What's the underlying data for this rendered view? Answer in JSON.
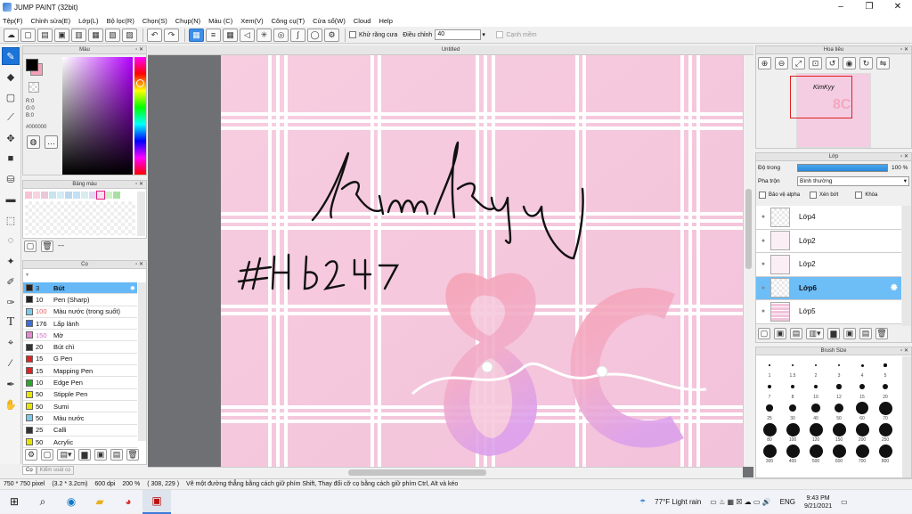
{
  "window": {
    "title": "JUMP PAINT (32bit)",
    "minimize": "–",
    "maximize": "❐",
    "close": "✕"
  },
  "menu": [
    "Tệp(F)",
    "Chỉnh sửa(E)",
    "Lớp(L)",
    "Bộ lọc(R)",
    "Chọn(S)",
    "Chụp(N)",
    "Màu (C)",
    "Xem(V)",
    "Công cụ(T)",
    "Cửa sổ(W)",
    "Cloud",
    "Help"
  ],
  "toolbar": {
    "antialias_label": "Khử răng cưa",
    "adjust_label": "Điều chỉnh",
    "adjust_value": "40",
    "grid_label": "Cạnh mềm"
  },
  "panels": {
    "color": "Màu",
    "swatch": "Bảng màu",
    "brush": "Cọ",
    "navigator": "Hoa tiêu",
    "layer": "Lớp",
    "brush_size": "Brush Size"
  },
  "color": {
    "r": "R:0",
    "g": "G:0",
    "b": "B:0",
    "hex": "#000000"
  },
  "canvas": {
    "tab_title": "Untitled",
    "signature": "KimKyy",
    "tag": "#Hb247",
    "big_text": "8C"
  },
  "brushes": [
    {
      "size": "3",
      "name": "Bút",
      "color": "#222222",
      "selected": true
    },
    {
      "size": "10",
      "name": "Pen (Sharp)",
      "color": "#222222"
    },
    {
      "size": "100",
      "name": "Màu nước (trong suốt)",
      "color": "#7ec8ea"
    },
    {
      "size": "176",
      "name": "Lấp lánh",
      "color": "#3b6fd8"
    },
    {
      "size": "150",
      "name": "Mờ",
      "color": "#e58ad0"
    },
    {
      "size": "20",
      "name": "Bút chì",
      "color": "#333333"
    },
    {
      "size": "15",
      "name": "G Pen",
      "color": "#e02424"
    },
    {
      "size": "15",
      "name": "Mapping Pen",
      "color": "#e02424"
    },
    {
      "size": "10",
      "name": "Edge Pen",
      "color": "#2aa82a"
    },
    {
      "size": "50",
      "name": "Stipple Pen",
      "color": "#e6e600"
    },
    {
      "size": "50",
      "name": "Sumi",
      "color": "#e6e600"
    },
    {
      "size": "50",
      "name": "Màu nước",
      "color": "#7ec8ea"
    },
    {
      "size": "25",
      "name": "Calli",
      "color": "#333333"
    },
    {
      "size": "50",
      "name": "Acrylic",
      "color": "#e6e600"
    }
  ],
  "brush_footer": {
    "tab1": "Cọ",
    "tab2": "Kiểm soát cọ"
  },
  "layer": {
    "opacity_label": "Độ trong",
    "opacity_value": "100 %",
    "blend_label": "Pha trộn",
    "blend_value": "Bình thường",
    "protect_alpha": "Bảo vệ alpha",
    "clipping": "Xén bớt",
    "lock": "Khóa"
  },
  "layers": [
    {
      "name": "Lớp4",
      "selected": false
    },
    {
      "name": "Lớp2",
      "selected": false
    },
    {
      "name": "Lớp2",
      "selected": false
    },
    {
      "name": "Lớp6",
      "selected": true
    },
    {
      "name": "Lớp5",
      "selected": false
    }
  ],
  "brush_sizes": [
    "1",
    "1.5",
    "2",
    "3",
    "4",
    "5",
    "7",
    "8",
    "10",
    "12",
    "15",
    "20",
    "25",
    "30",
    "40",
    "50",
    "60",
    "70",
    "80",
    "100",
    "120",
    "150",
    "200",
    "250",
    "300",
    "400",
    "500",
    "600",
    "700",
    "800",
    "1000"
  ],
  "status": {
    "dimensions": "750 * 750 pixel",
    "physical": "(3.2 * 3.2cm)",
    "dpi": "600 dpi",
    "zoom": "200 %",
    "coords": "( 308, 229 )",
    "hint": "Vẽ một đường thẳng bằng cách giữ phím Shift, Thay đổi cỡ cọ bằng cách giữ phím Ctrl, Alt và kéo"
  },
  "taskbar": {
    "weather": "77°F  Light rain",
    "lang": "ENG",
    "time": "9:43 PM",
    "date": "9/21/2021"
  }
}
